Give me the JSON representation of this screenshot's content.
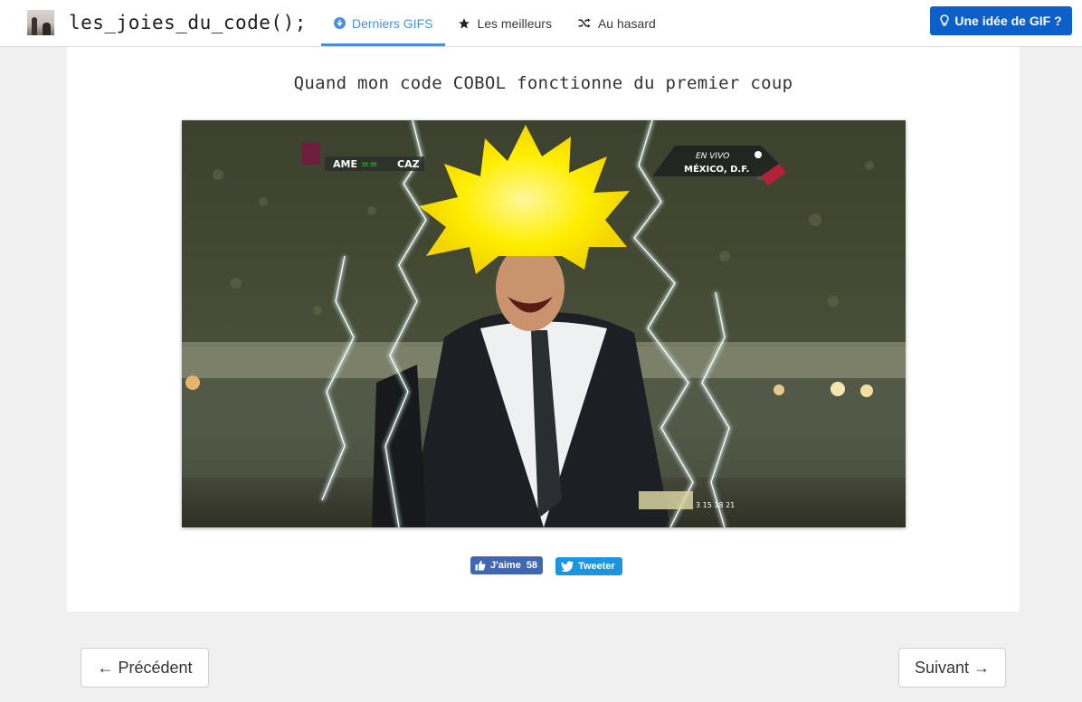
{
  "brand": {
    "name": "les_joies_du_code();"
  },
  "nav": {
    "items": [
      {
        "label": "Derniers GIFS",
        "icon": "arrow-circle-down-icon",
        "active": true
      },
      {
        "label": "Les meilleurs",
        "icon": "star-icon",
        "active": false
      },
      {
        "label": "Au hasard",
        "icon": "shuffle-icon",
        "active": false
      }
    ]
  },
  "cta": {
    "label": "Une idée de GIF ?",
    "icon": "lightbulb-icon"
  },
  "post": {
    "title": "Quand mon code COBOL fonctionne du premier coup",
    "gif": {
      "score_left": "AME",
      "score_mid": "== ",
      "score_right": "CAZ",
      "live_label": "EN VIVO",
      "location": "MÉXICO, D.F.",
      "timer": "3  15  18  21"
    }
  },
  "social": {
    "like_label": "J'aime",
    "like_count": "58",
    "tweet_label": "Tweeter"
  },
  "pager": {
    "prev_label": "← Précédent",
    "next_label": "Suivant →"
  },
  "colors": {
    "accent": "#4a8fde",
    "cta": "#0d5fc9",
    "facebook": "#4267b2",
    "twitter": "#1b95e0"
  }
}
